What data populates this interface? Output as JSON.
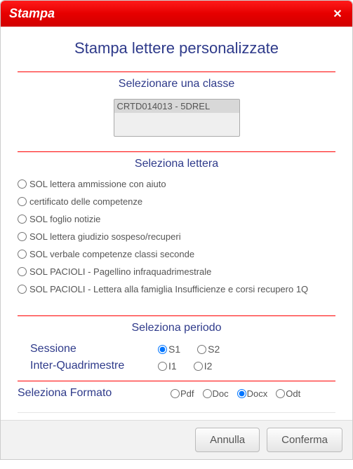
{
  "dialog": {
    "title": "Stampa",
    "main_heading": "Stampa lettere personalizzate"
  },
  "section_class": {
    "title": "Selezionare una classe",
    "options": [
      "CRTD014013 - 5DREL"
    ]
  },
  "section_letter": {
    "title": "Seleziona lettera",
    "items": [
      "SOL lettera ammissione con aiuto",
      "certificato delle competenze",
      "SOL foglio notizie",
      "SOL lettera giudizio sospeso/recuperi",
      "SOL verbale competenze classi seconde",
      "SOL PACIOLI - Pagellino infraquadrimestrale",
      "SOL PACIOLI - Lettera alla famiglia Insufficienze e corsi recupero 1Q"
    ]
  },
  "section_period": {
    "title": "Seleziona periodo",
    "rows": [
      {
        "label": "Sessione",
        "opt1": "S1",
        "opt2": "S2",
        "selected": "S1"
      },
      {
        "label": "Inter-Quadrimestre",
        "opt1": "I1",
        "opt2": "I2",
        "selected": ""
      }
    ]
  },
  "section_format": {
    "label": "Seleziona Formato",
    "options": [
      "Pdf",
      "Doc",
      "Docx",
      "Odt"
    ],
    "selected": "Docx"
  },
  "buttons": {
    "cancel": "Annulla",
    "confirm": "Conferma"
  }
}
